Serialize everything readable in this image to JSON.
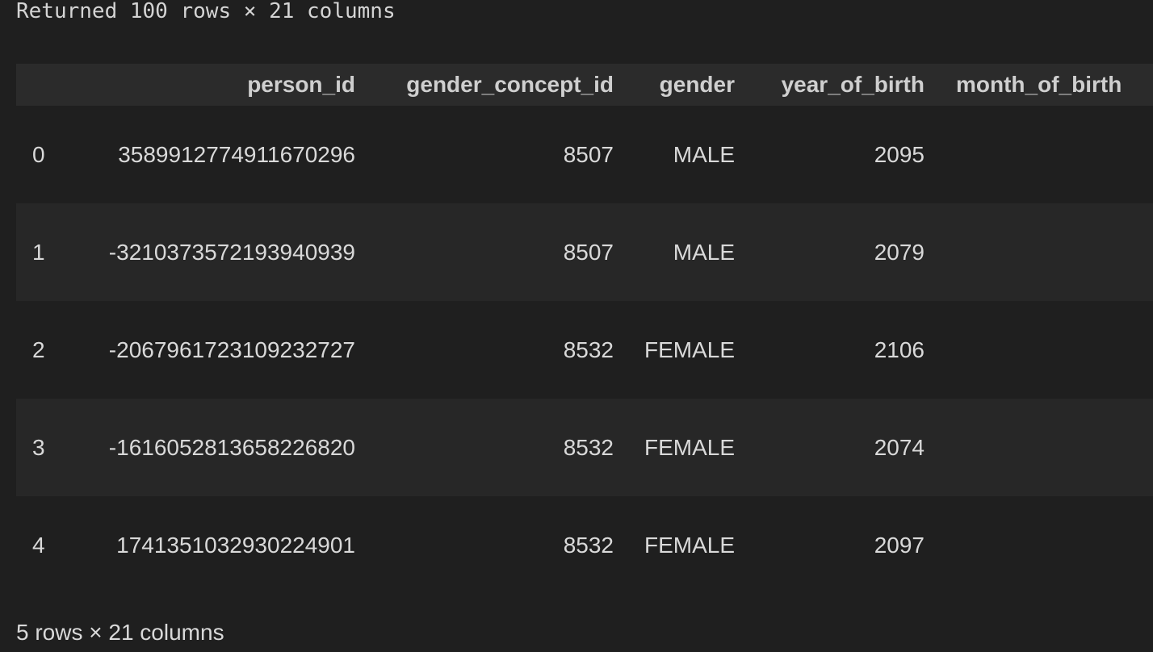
{
  "summary_text": "Returned 100 rows × 21 columns",
  "table": {
    "columns": [
      "",
      "person_id",
      "gender_concept_id",
      "gender",
      "year_of_birth",
      "month_of_birth"
    ],
    "rows": [
      {
        "index": "0",
        "person_id": "3589912774911670296",
        "gender_concept_id": "8507",
        "gender": "MALE",
        "year_of_birth": "2095",
        "month_of_birth": ""
      },
      {
        "index": "1",
        "person_id": "-3210373572193940939",
        "gender_concept_id": "8507",
        "gender": "MALE",
        "year_of_birth": "2079",
        "month_of_birth": ""
      },
      {
        "index": "2",
        "person_id": "-2067961723109232727",
        "gender_concept_id": "8532",
        "gender": "FEMALE",
        "year_of_birth": "2106",
        "month_of_birth": ""
      },
      {
        "index": "3",
        "person_id": "-1616052813658226820",
        "gender_concept_id": "8532",
        "gender": "FEMALE",
        "year_of_birth": "2074",
        "month_of_birth": ""
      },
      {
        "index": "4",
        "person_id": "1741351032930224901",
        "gender_concept_id": "8532",
        "gender": "FEMALE",
        "year_of_birth": "2097",
        "month_of_birth": ""
      }
    ]
  },
  "footer_text": "5 rows × 21 columns"
}
